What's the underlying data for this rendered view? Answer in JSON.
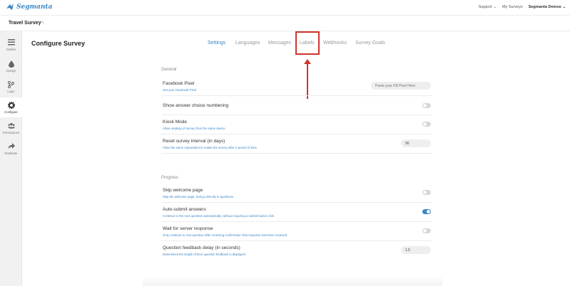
{
  "app": {
    "logo_text": "Segmanta",
    "brand_color": "#3d86c6"
  },
  "topnav": {
    "support": "Support ⌄",
    "my_surveys": "My Surveys",
    "account": "Segmanta Demos ⌄"
  },
  "survey": {
    "title": "Travel Survey"
  },
  "sidebar": {
    "items": [
      {
        "label": "Outline",
        "icon": "list-icon"
      },
      {
        "label": "Design",
        "icon": "droplet-icon"
      },
      {
        "label": "Logic",
        "icon": "branch-icon"
      },
      {
        "label": "Configure",
        "icon": "gear-icon",
        "active": true
      },
      {
        "label": "Permissions",
        "icon": "users-icon"
      },
      {
        "label": "Distribute",
        "icon": "share-icon"
      }
    ]
  },
  "header": {
    "page_title": "Configure Survey",
    "tabs": [
      {
        "label": "Settings",
        "active": true
      },
      {
        "label": "Languages"
      },
      {
        "label": "Messages"
      },
      {
        "label": "Labels"
      },
      {
        "label": "Webhooks"
      },
      {
        "label": "Survey Goals"
      }
    ]
  },
  "annotation": {
    "highlight_color": "#d0342c"
  },
  "general": {
    "section_label": "General",
    "rows": [
      {
        "title": "Facebook Pixel",
        "sub": "Get your Facebook Pixel",
        "control": "input",
        "placeholder": "Paste your FB Pixel Here"
      },
      {
        "title": "Show answer choice numbering",
        "sub": "",
        "control": "toggle",
        "on": false
      },
      {
        "title": "Kiosk Mode",
        "sub": "Allow retaking of survey from the same device",
        "control": "toggle",
        "on": false
      },
      {
        "title": "Reset survey interval (in days)",
        "sub": "Allow the same respondent to retake the survey after X period of time",
        "control": "input",
        "value": "90"
      }
    ]
  },
  "progress": {
    "section_label": "Progress",
    "rows": [
      {
        "title": "Skip welcome page",
        "sub": "Skip the welcome page, and go directly to questions",
        "control": "toggle",
        "on": false
      },
      {
        "title": "Auto-submit answers",
        "sub": "Continue to the next question automatically, without requiring a submit button click",
        "control": "toggle",
        "on": true
      },
      {
        "title": "Wait for server response",
        "sub": "Only continue to next question after receiving confirmation that response has been received",
        "control": "toggle",
        "on": false
      },
      {
        "title": "Question feedback delay (in seconds)",
        "sub": "Determines the length of time question feedback is displayed",
        "control": "input",
        "value": "1.5"
      }
    ]
  }
}
